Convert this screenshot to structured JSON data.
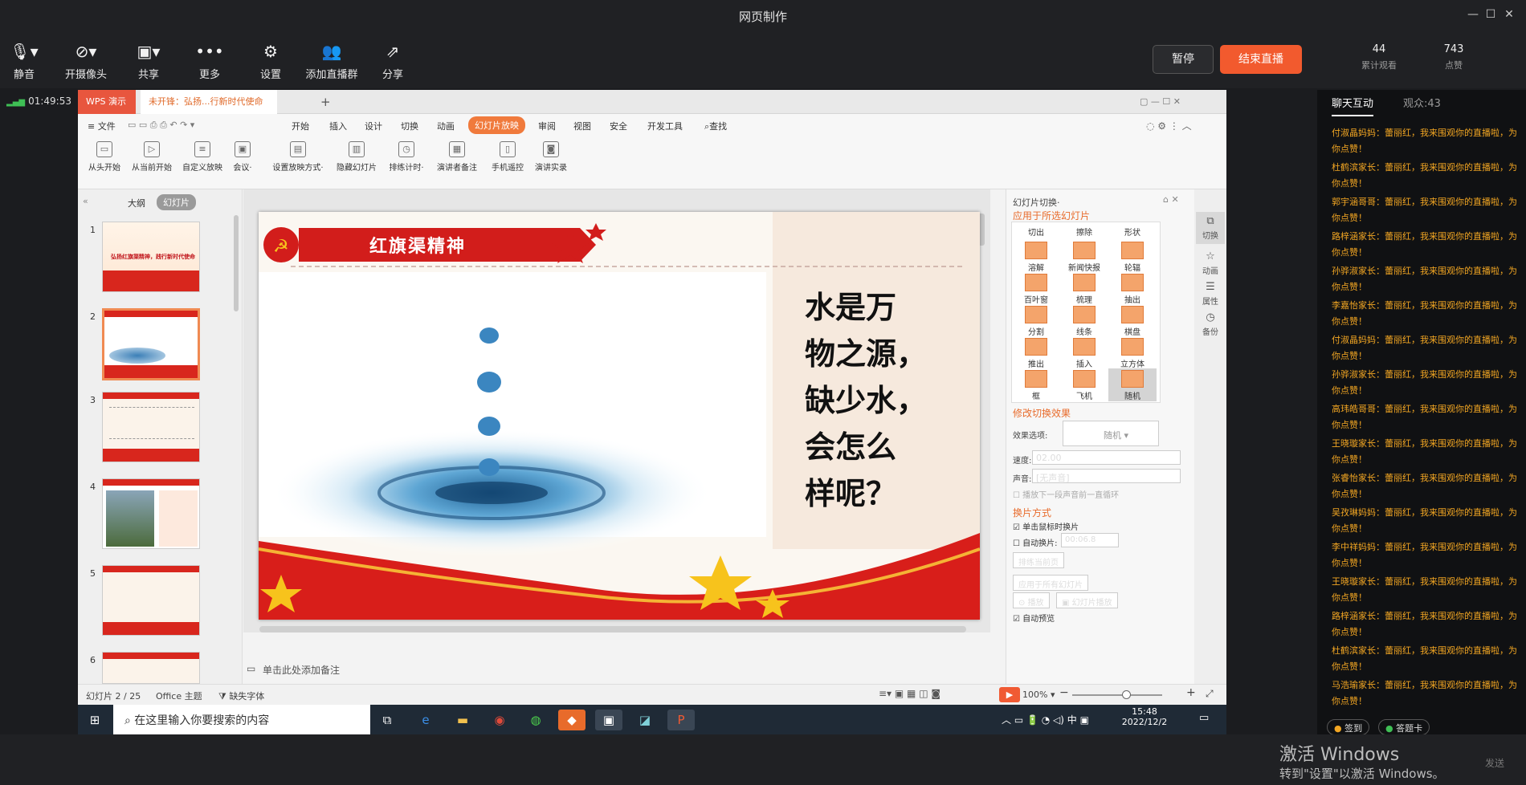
{
  "window": {
    "title": "网页制作"
  },
  "toolbar": {
    "items": [
      {
        "label": "静音",
        "icon": "microphone-icon"
      },
      {
        "label": "开摄像头",
        "icon": "camera-off-icon"
      },
      {
        "label": "共享",
        "icon": "share-screen-icon"
      },
      {
        "label": "更多",
        "icon": "more-icon"
      },
      {
        "label": "设置",
        "icon": "gear-icon"
      },
      {
        "label": "添加直播群",
        "icon": "add-group-icon"
      },
      {
        "label": "分享",
        "icon": "share-icon"
      }
    ],
    "pause": "暂停",
    "end": "结束直播",
    "stats": [
      {
        "value": "44",
        "label": "累计观看"
      },
      {
        "value": "743",
        "label": "点赞"
      }
    ]
  },
  "timer": "01:49:53",
  "wps": {
    "tabs": [
      "WPS 演示",
      "未开锋：弘扬...行新时代使命"
    ],
    "menu": [
      "≡ 文件",
      "开始",
      "插入",
      "设计",
      "切换",
      "动画",
      "幻灯片放映",
      "审阅",
      "视图",
      "安全",
      "开发工具",
      "查找"
    ],
    "ribbon": [
      "从头开始",
      "从当前开始",
      "自定义放映",
      "会议·",
      "设置放映方式·",
      "隐藏幻灯片",
      "排练计时·",
      "演讲者备注",
      "手机遥控",
      "演讲实录"
    ],
    "thumb_tabs": [
      "大纲",
      "幻灯片"
    ],
    "slide_title": "红旗渠精神",
    "slide_text": [
      "水是万",
      "物之源，",
      "缺少水，",
      "会怎么",
      "样呢？"
    ],
    "thumb_titles": [
      "弘扬红旗渠精神，践行新时代使命"
    ],
    "notes": "单击此处添加备注",
    "panel": {
      "title": "幻灯片切换·",
      "apply_label": "应用于所选幻灯片",
      "transitions": [
        "切出",
        "擦除",
        "形状",
        "溶解",
        "新闻快报",
        "轮辐",
        "百叶窗",
        "梳理",
        "抽出",
        "分割",
        "线条",
        "棋盘",
        "推出",
        "插入",
        "立方体",
        "框",
        "飞机",
        "随机"
      ],
      "modify": "修改切换效果",
      "effect_label": "效果选项:",
      "effect_value": "随机",
      "speed_label": "速度:",
      "speed_value": "02.00",
      "sound_label": "声音:",
      "sound_value": "[无声音]",
      "loop": "播放下一段声音前一直循环",
      "advance": "换片方式",
      "on_click": "单击鼠标时换片",
      "auto": "自动换片:",
      "auto_value": "00:06.8",
      "rehearse": "排练当前页",
      "apply_all": "应用于所有幻灯片",
      "play": "播放",
      "slideshow": "幻灯片播放",
      "autopreview": "自动预览"
    },
    "rail": [
      "切换",
      "动画",
      "属性",
      "备份"
    ],
    "status": {
      "slide": "幻灯片 2 / 25",
      "theme": "Office 主题",
      "font": "缺失字体",
      "zoom": "100%"
    }
  },
  "taskbar": {
    "search": "在这里输入你要搜索的内容",
    "time": "15:48",
    "date": "2022/12/2",
    "lang": "中"
  },
  "chat": {
    "tabs": [
      "聊天互动",
      "观众:43"
    ],
    "messages": [
      "付淑晶妈妈：蕾丽红，我来围观你的直播啦，为你点赞！",
      "杜鹤滨家长：蕾丽红，我来围观你的直播啦，为你点赞！",
      "郭宇涵哥哥：蕾丽红，我来围观你的直播啦，为你点赞！",
      "路梓涵家长：蕾丽红，我来围观你的直播啦，为你点赞！",
      "孙骅淑家长：蕾丽红，我来围观你的直播啦，为你点赞！",
      "李嘉怡家长：蕾丽红，我来围观你的直播啦，为你点赞！",
      "付淑晶妈妈：蕾丽红，我来围观你的直播啦，为你点赞！",
      "孙骅淑家长：蕾丽红，我来围观你的直播啦，为你点赞！",
      "高玮皓哥哥：蕾丽红，我来围观你的直播啦，为你点赞！",
      "王晓璇家长：蕾丽红，我来围观你的直播啦，为你点赞！",
      "张睿怡家长：蕾丽红，我来围观你的直播啦，为你点赞！",
      "吴孜琳妈妈：蕾丽红，我来围观你的直播啦，为你点赞！",
      "李中祥妈妈：蕾丽红，我来围观你的直播啦，为你点赞！",
      "王晓璇家长：蕾丽红，我来围观你的直播啦，为你点赞！",
      "路梓涵家长：蕾丽红，我来围观你的直播啦，为你点赞！",
      "杜鹤滨家长：蕾丽红，我来围观你的直播啦，为你点赞！",
      "马浩瑜家长：蕾丽红，我来围观你的直播啦，为你点赞！"
    ],
    "signin": "签到",
    "answer": "答题卡",
    "send": "发送"
  },
  "activation": {
    "title": "激活 Windows",
    "sub": "转到\"设置\"以激活 Windows。"
  }
}
